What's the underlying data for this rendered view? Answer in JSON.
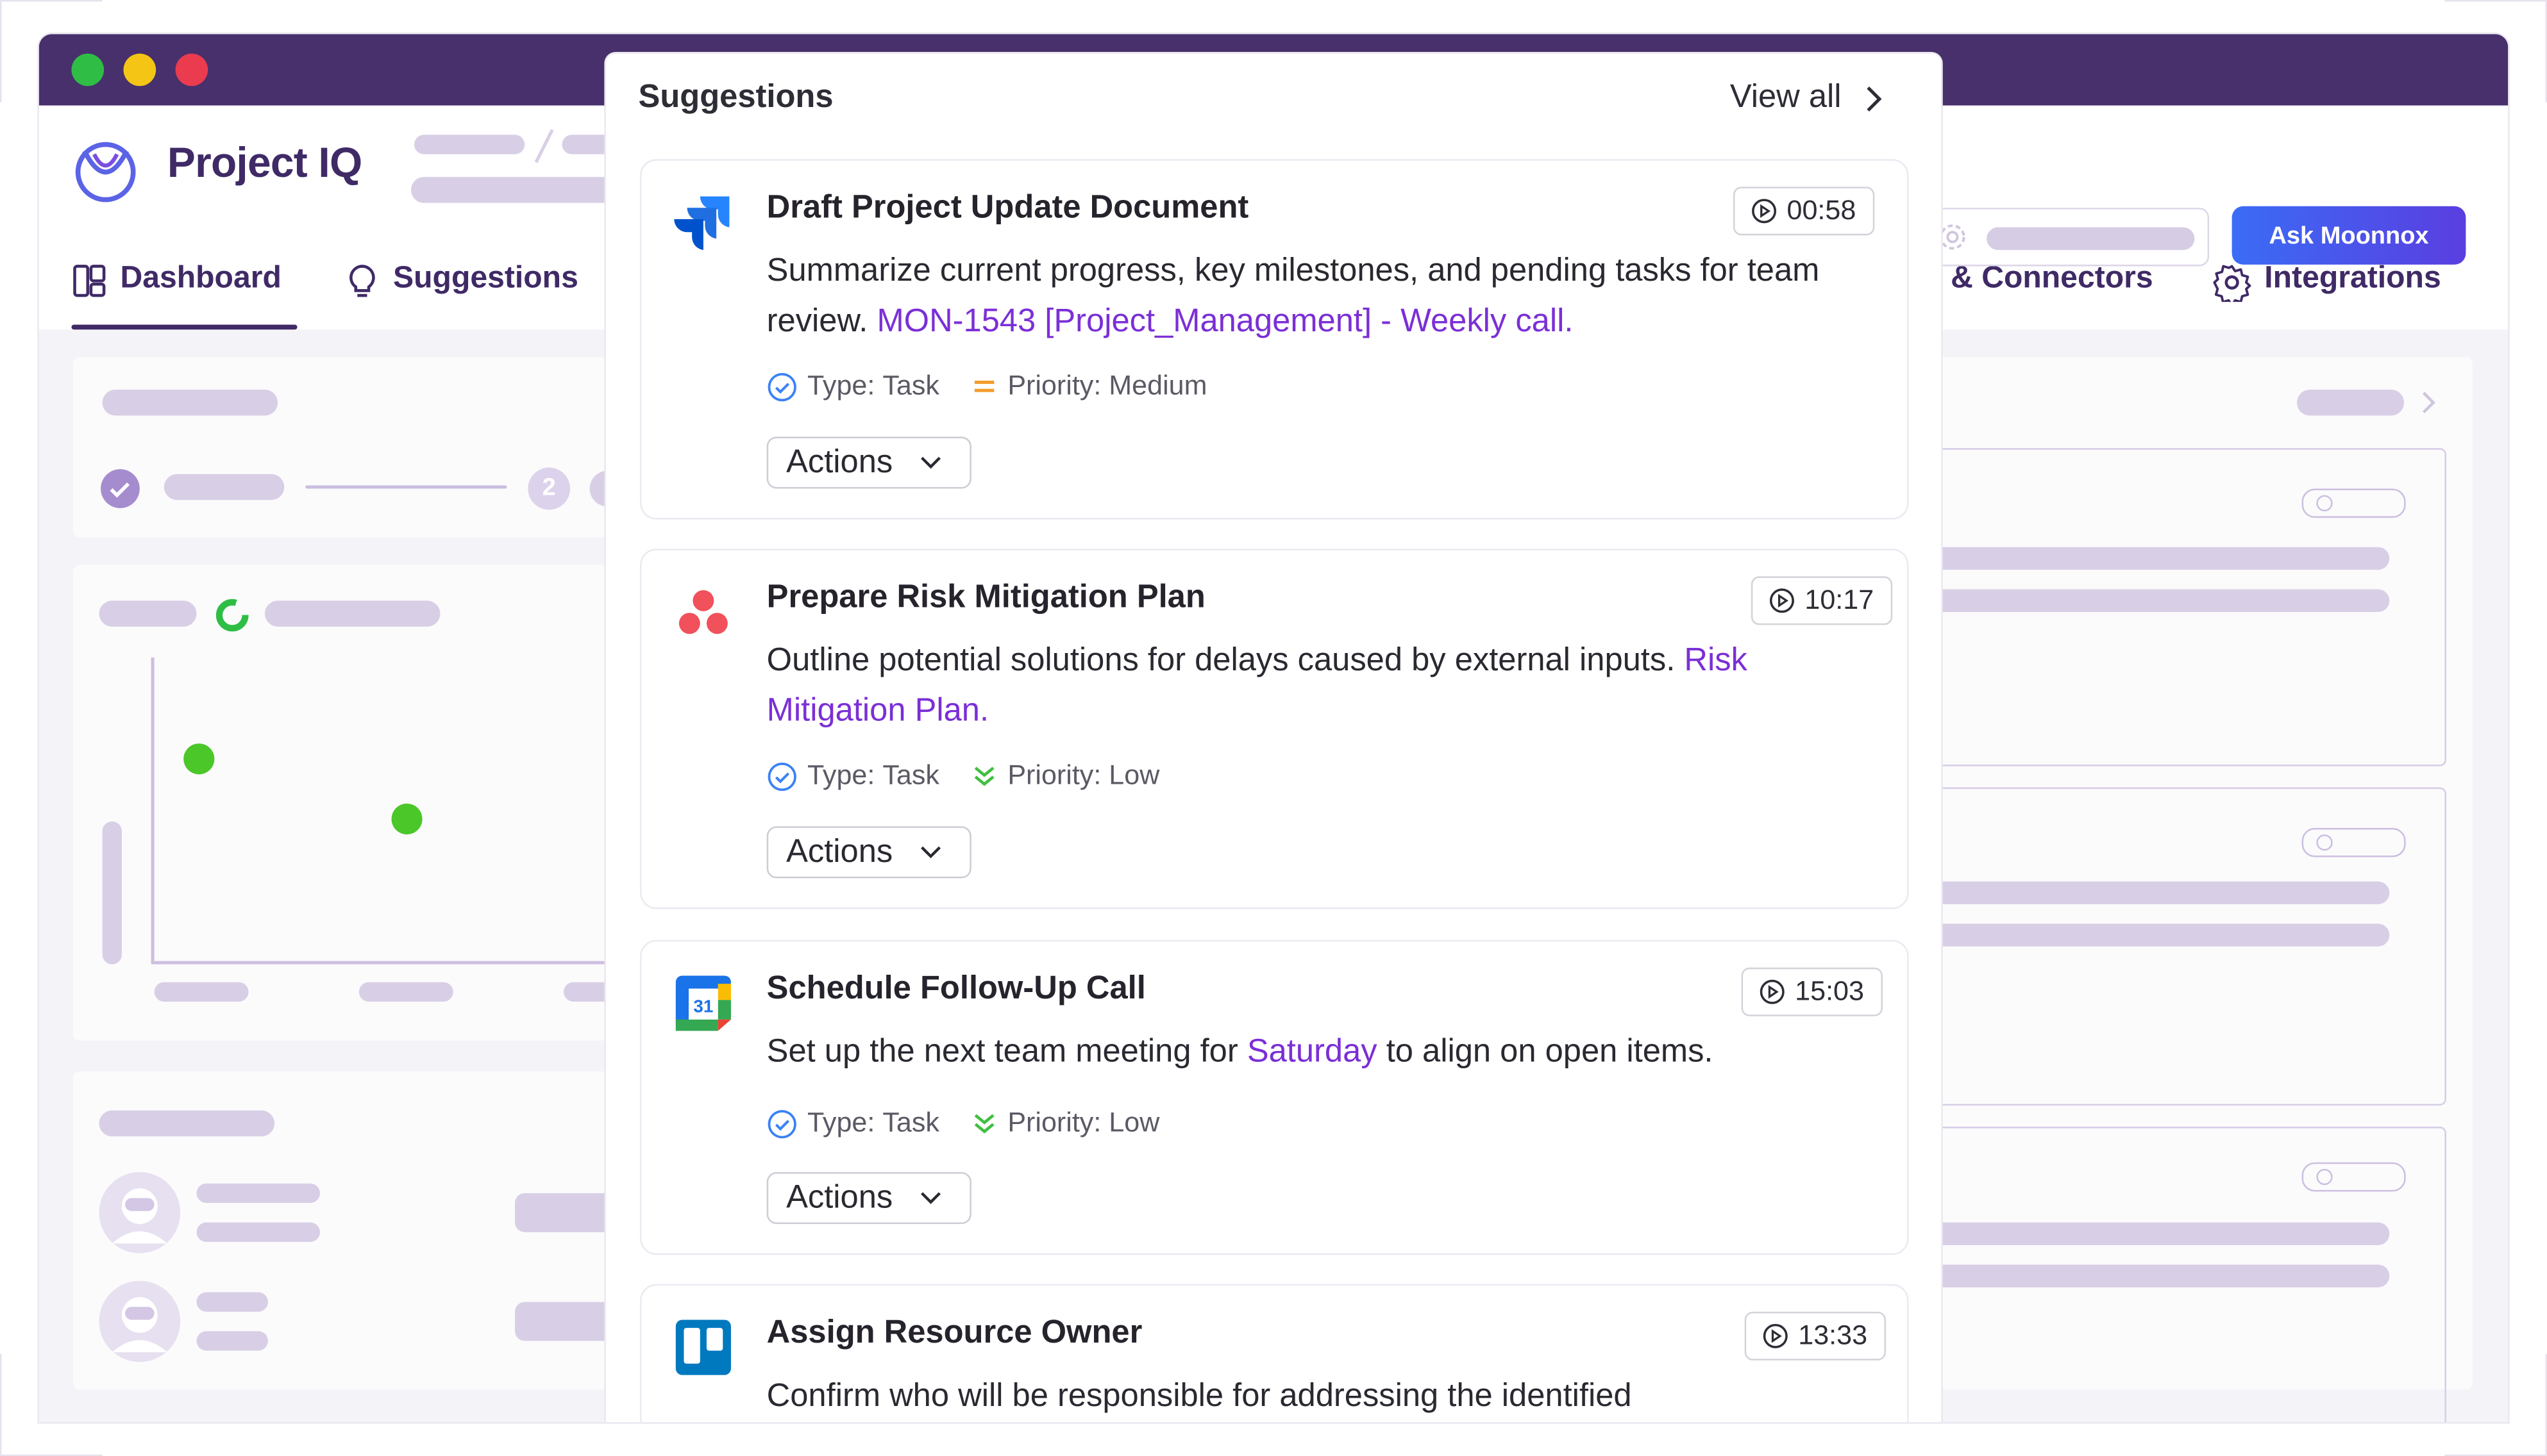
{
  "app": {
    "brand": "Project IQ",
    "ask_button": "Ask Moonnox",
    "nav": {
      "dashboard": "Dashboard",
      "suggestions": "Suggestions",
      "connectors": "n & Connectors",
      "integrations": "Integrations"
    },
    "step_number": "2"
  },
  "suggestions": {
    "title": "Suggestions",
    "view_all": "View all",
    "cards": [
      {
        "app_icon": "jira-icon",
        "title": "Draft Project Update Document",
        "duration": "00:58",
        "desc_text": "Summarize current progress, key milestones, and pending tasks for team review. ",
        "desc_link": "MON-1543 [Project_Management] - Weekly call.",
        "type_label": "Type:",
        "type_value": "Task",
        "priority_label": "Priority:",
        "priority_value": "Medium",
        "actions_label": "Actions"
      },
      {
        "app_icon": "asana-icon",
        "title": "Prepare Risk Mitigation Plan",
        "duration": "10:17",
        "desc_text": "Outline potential solutions for delays caused by external inputs. ",
        "desc_link": "Risk Mitigation Plan.",
        "type_label": "Type:",
        "type_value": "Task",
        "priority_label": "Priority:",
        "priority_value": "Low",
        "actions_label": "Actions"
      },
      {
        "app_icon": "google-calendar-icon",
        "calendar_day": "31",
        "title": "Schedule Follow-Up Call",
        "duration": "15:03",
        "desc_before": "Set up the next team meeting for ",
        "desc_link": "Saturday",
        "desc_after": " to align on open items.",
        "type_label": "Type:",
        "type_value": "Task",
        "priority_label": "Priority:",
        "priority_value": "Low",
        "actions_label": "Actions"
      },
      {
        "app_icon": "trello-icon",
        "title": "Assign Resource Owner",
        "duration": "13:33",
        "desc_text": "Confirm who will be responsible for addressing the identified"
      }
    ]
  },
  "colors": {
    "titlebar": "#47306b",
    "brand": "#3f2a66",
    "link": "#7b2fd6",
    "skeleton": "#d8cfe6",
    "priority_medium": "#f59b2b",
    "priority_low": "#3fbf3f",
    "type_icon": "#3b82f6"
  }
}
